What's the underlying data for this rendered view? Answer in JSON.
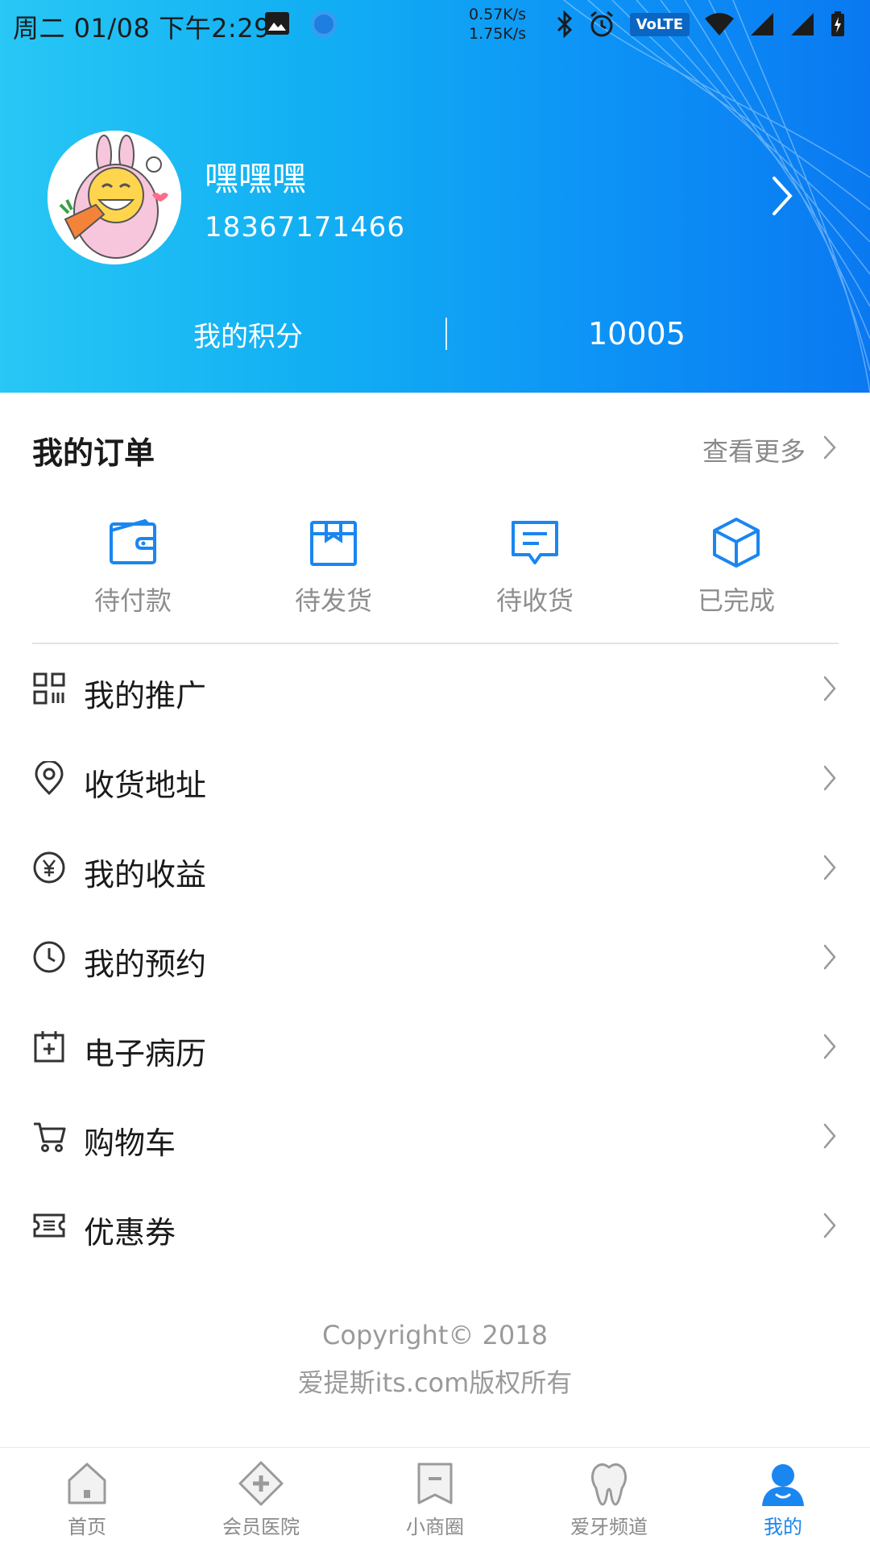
{
  "status_bar": {
    "time": "周二 01/08 下午2:29",
    "speed_up": "0.57K/s",
    "speed_down": "1.75K/s",
    "volte": "VoLTE"
  },
  "profile": {
    "name": "嘿嘿嘿",
    "phone": "18367171466",
    "points_label": "我的积分",
    "points_value": "10005"
  },
  "orders": {
    "title": "我的订单",
    "more_label": "查看更多",
    "items": [
      {
        "label": "待付款",
        "icon": "wallet-icon"
      },
      {
        "label": "待发货",
        "icon": "package-icon"
      },
      {
        "label": "待收货",
        "icon": "message-icon"
      },
      {
        "label": "已完成",
        "icon": "cube-icon"
      }
    ]
  },
  "menu": [
    {
      "label": "我的推广",
      "icon": "qr-grid-icon"
    },
    {
      "label": "收货地址",
      "icon": "location-pin-icon"
    },
    {
      "label": "我的收益",
      "icon": "yen-circle-icon"
    },
    {
      "label": "我的预约",
      "icon": "clock-icon"
    },
    {
      "label": "电子病历",
      "icon": "calendar-plus-icon"
    },
    {
      "label": "购物车",
      "icon": "cart-icon"
    },
    {
      "label": "优惠券",
      "icon": "coupon-icon"
    }
  ],
  "footer": {
    "copyright": "Copyright© 2018",
    "rights": "爱提斯its.com版权所有"
  },
  "tabs": [
    {
      "label": "首页",
      "icon": "home-icon"
    },
    {
      "label": "会员医院",
      "icon": "hospital-icon"
    },
    {
      "label": "小商圈",
      "icon": "bookmark-icon"
    },
    {
      "label": "爱牙频道",
      "icon": "tooth-icon"
    },
    {
      "label": "我的",
      "icon": "user-icon",
      "active": true
    }
  ],
  "colors": {
    "accent": "#1a86f0",
    "header_start": "#28c7f5",
    "header_end": "#0a79f1"
  }
}
